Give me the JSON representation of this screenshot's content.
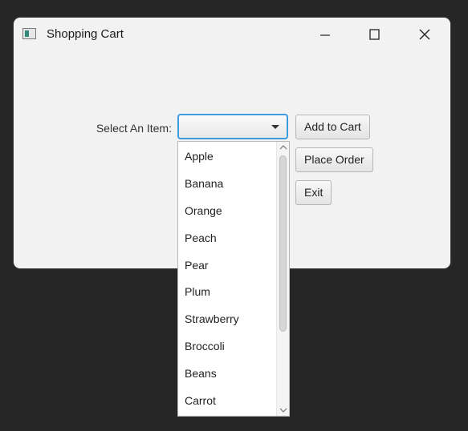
{
  "window": {
    "title": "Shopping Cart"
  },
  "form": {
    "select_label": "Select An Item:",
    "combo_value": ""
  },
  "buttons": {
    "add_to_cart": "Add to Cart",
    "place_order": "Place Order",
    "exit": "Exit"
  },
  "dropdown": {
    "items": [
      "Apple",
      "Banana",
      "Orange",
      "Peach",
      "Pear",
      "Plum",
      "Strawberry",
      "Broccoli",
      "Beans",
      "Carrot"
    ]
  },
  "icons": {
    "app": "app-window-icon",
    "minimize": "minimize-icon",
    "maximize": "maximize-icon",
    "close": "close-icon",
    "combo_arrow": "chevron-down-icon",
    "scroll_up": "chevron-up-icon",
    "scroll_down": "chevron-down-icon"
  },
  "colors": {
    "focus_border": "#3d9be0",
    "window_bg": "#f2f2f2",
    "desktop_bg": "#262626"
  }
}
